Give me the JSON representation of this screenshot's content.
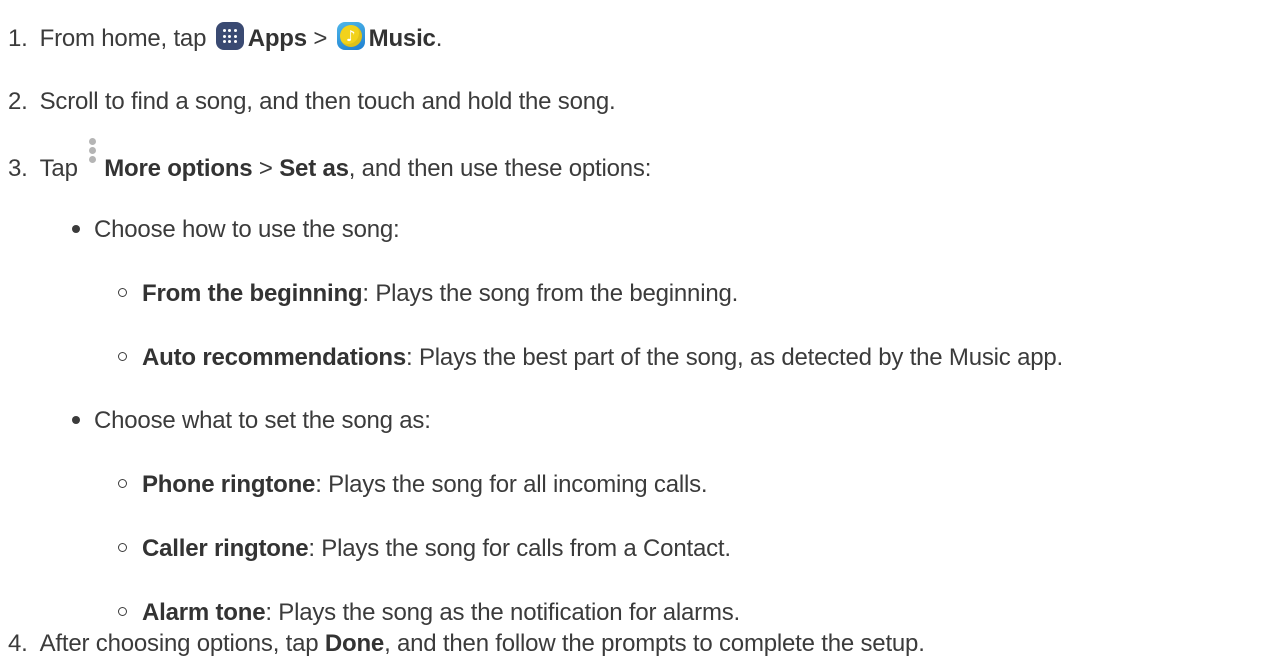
{
  "steps": [
    {
      "number": "1.",
      "text_before": "From home, tap",
      "icon1_name": "apps-icon",
      "label1": "Apps",
      "separator": " > ",
      "icon2_name": "music-icon",
      "label2": "Music",
      "text_after": "."
    },
    {
      "number": "2.",
      "text": "Scroll to find a song, and then touch and hold the song."
    },
    {
      "number": "3.",
      "text_before": "Tap",
      "icon_name": "more-options-icon",
      "label1": "More options",
      "separator": " > ",
      "label2": "Set as",
      "text_after": ", and then use these options:"
    },
    {
      "number": "4.",
      "text_before": "After choosing options, tap",
      "label": "Done",
      "text_after": ", and then follow the prompts to complete the setup."
    }
  ],
  "groups": [
    {
      "heading": "Choose how to use the song:",
      "items": [
        {
          "term": "From the beginning",
          "desc": ": Plays the song from the beginning."
        },
        {
          "term": "Auto recommendations",
          "desc": ": Plays the best part of the song, as detected by the Music app."
        }
      ]
    },
    {
      "heading": "Choose what to set the song as:",
      "items": [
        {
          "term": "Phone ringtone",
          "desc": ": Plays the song for all incoming calls."
        },
        {
          "term": "Caller ringtone",
          "desc": ": Plays the song for calls from a Contact."
        },
        {
          "term": "Alarm tone",
          "desc": ": Plays the song as the notification for alarms."
        }
      ]
    }
  ],
  "colors": {
    "text": "#3b3b3b",
    "apps_icon": "#3a4a72",
    "music_icon_bg": "#1e7fd0",
    "music_icon_circle": "#f2d21b",
    "more_icon": "#b5b5b5"
  }
}
